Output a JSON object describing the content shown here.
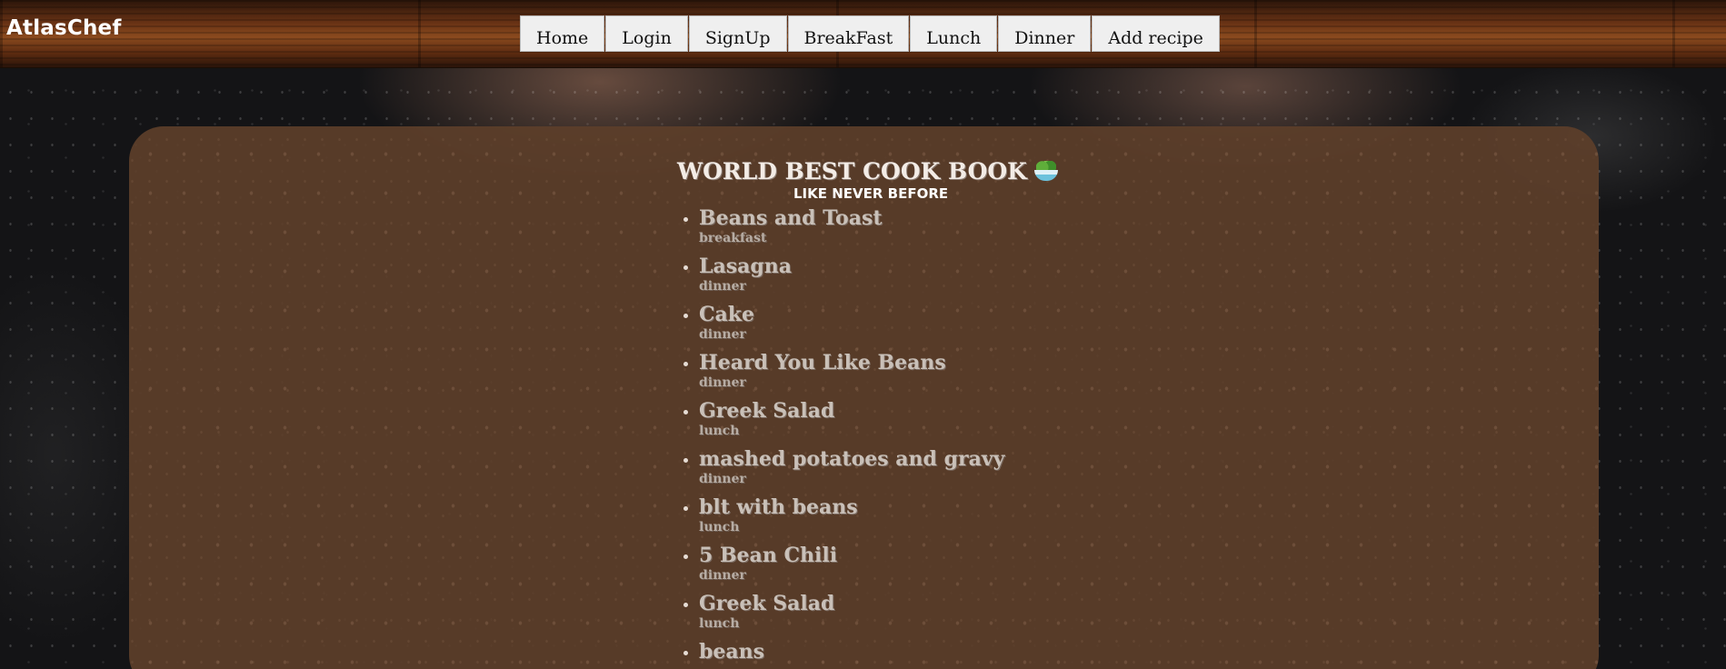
{
  "header": {
    "brand": "AtlasChef",
    "nav": [
      {
        "label": "Home"
      },
      {
        "label": "Login"
      },
      {
        "label": "SignUp"
      },
      {
        "label": "BreakFast"
      },
      {
        "label": "Lunch"
      },
      {
        "label": "Dinner"
      },
      {
        "label": "Add recipe"
      }
    ]
  },
  "main": {
    "title": "WORLD BEST COOK BOOK",
    "title_icon": "salad-bowl-icon",
    "subtitle": "LIKE NEVER BEFORE",
    "recipes": [
      {
        "name": "Beans and Toast",
        "category": "breakfast"
      },
      {
        "name": "Lasagna",
        "category": "dinner"
      },
      {
        "name": "Cake",
        "category": "dinner"
      },
      {
        "name": "Heard You Like Beans",
        "category": "dinner"
      },
      {
        "name": "Greek Salad",
        "category": "lunch"
      },
      {
        "name": "mashed potatoes and gravy",
        "category": "dinner"
      },
      {
        "name": "blt with beans",
        "category": "lunch"
      },
      {
        "name": "5 Bean Chili",
        "category": "dinner"
      },
      {
        "name": "Greek Salad",
        "category": "lunch"
      },
      {
        "name": "beans",
        "category": ""
      }
    ]
  },
  "colors": {
    "panel": "#5c3e2a",
    "nav_button_bg": "#efefef",
    "page_bg": "#141416"
  }
}
